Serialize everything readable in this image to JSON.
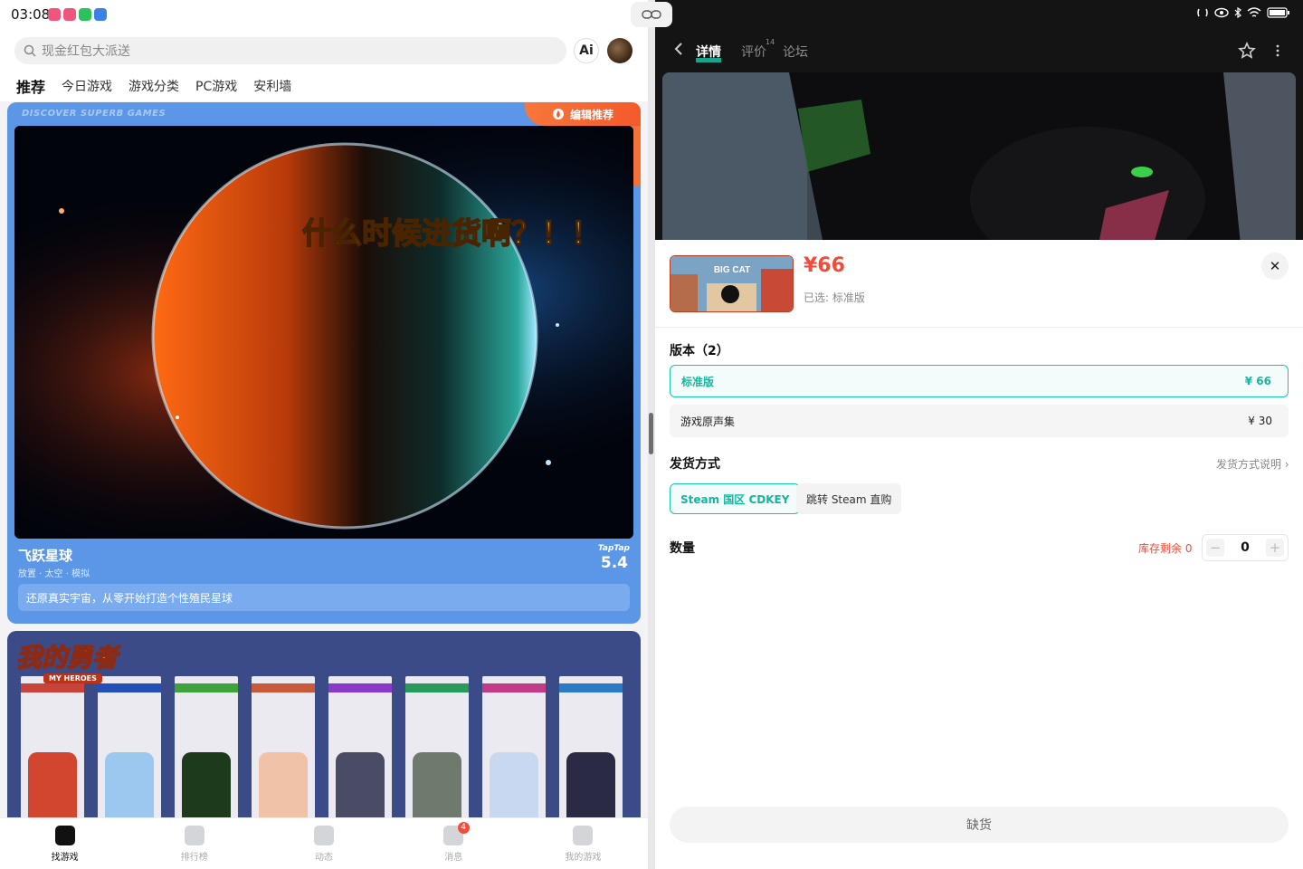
{
  "left": {
    "status": {
      "time": "03:08"
    },
    "search": {
      "placeholder": "现金红包大派送",
      "ai_label": "Ai"
    },
    "tabs": [
      {
        "label": "推荐",
        "active": true
      },
      {
        "label": "今日游戏"
      },
      {
        "label": "游戏分类"
      },
      {
        "label": "PC游戏"
      },
      {
        "label": "安利墙"
      }
    ],
    "featured": {
      "kicker": "DISCOVER SUPERB GAMES",
      "badge": "编辑推荐",
      "overlay_text": "什么时候进货啊？！！",
      "title": "飞跃星球",
      "tags": "放置 · 太空 · 模拟",
      "rating_source": "TapTap",
      "rating": "5.4",
      "description": "还原真实宇宙，从零开始打造个性殖民星球"
    },
    "second_card": {
      "logo_text": "我的勇者",
      "logo_sub": "MY HEROES"
    },
    "bottom_nav": [
      {
        "label": "找游戏",
        "active": true
      },
      {
        "label": "排行榜"
      },
      {
        "label": "动态"
      },
      {
        "label": "消息",
        "badge": "4"
      },
      {
        "label": "我的游戏"
      }
    ]
  },
  "right": {
    "tabs": [
      {
        "label": "详情",
        "active": true
      },
      {
        "label": "评价",
        "sup": "14"
      },
      {
        "label": "论坛"
      }
    ],
    "sheet": {
      "price": "¥66",
      "selected_text": "已选: 标准版",
      "thumb_text": "BIG CAT",
      "edition_title": "版本（2）",
      "editions": [
        {
          "name": "标准版",
          "price": "¥ 66",
          "selected": true
        },
        {
          "name": "游戏原声集",
          "price": "¥ 30"
        }
      ],
      "delivery_title": "发货方式",
      "delivery_help": "发货方式说明",
      "delivery_options": [
        {
          "label": "Steam 国区 CDKEY",
          "selected": true
        },
        {
          "label": "跳转 Steam 直购"
        }
      ],
      "quantity_title": "数量",
      "stock_text": "库存剩余 0",
      "quantity": "0",
      "buy_label": "缺货"
    }
  },
  "colors": {
    "accent": "#19d3b6",
    "price": "#f24b3a",
    "card_blue": "#5b97e6",
    "badge_orange": "#f35a2a"
  }
}
